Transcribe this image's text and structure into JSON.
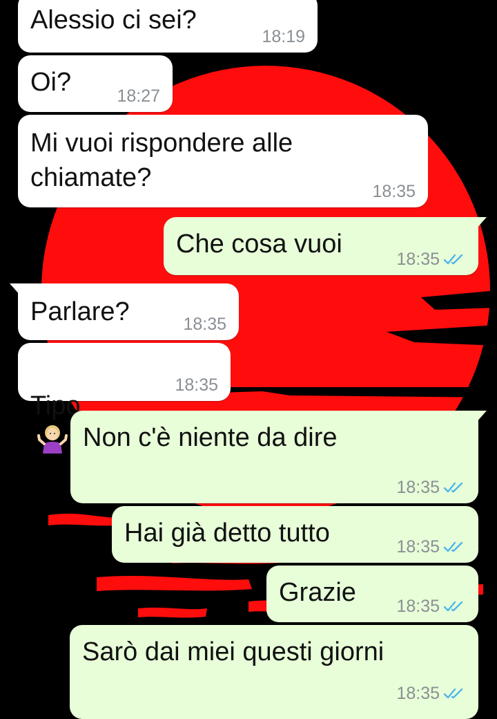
{
  "theme": {
    "incoming_bubble": "#ffffff",
    "outgoing_bubble": "#e7fed8",
    "tick_color": "#4fb6ec",
    "wallpaper_sun": "#ff0d0d",
    "wallpaper_bg": "#000000"
  },
  "messages": [
    {
      "direction": "in",
      "text": "Alessio ci sei?",
      "time": "18:19"
    },
    {
      "direction": "in",
      "text": "Oi?",
      "time": "18:27"
    },
    {
      "direction": "in",
      "text": "Mi vuoi rispondere alle\nchiamate?",
      "time": "18:35"
    },
    {
      "direction": "out",
      "text": "Che cosa vuoi",
      "time": "18:35",
      "status": "read"
    },
    {
      "direction": "in",
      "text": "Parlare?",
      "time": "18:35"
    },
    {
      "direction": "in",
      "text": "Tipo",
      "emoji": "person-shrugging-emoji",
      "time": "18:35"
    },
    {
      "direction": "out",
      "text": "Non c'è niente da dire",
      "time": "18:35",
      "status": "read"
    },
    {
      "direction": "out",
      "text": "Hai già detto tutto",
      "time": "18:35",
      "status": "read"
    },
    {
      "direction": "out",
      "text": "Grazie",
      "time": "18:35",
      "status": "read"
    },
    {
      "direction": "out",
      "text": "Sarò dai miei questi giorni",
      "time": "18:35",
      "status": "read"
    }
  ]
}
